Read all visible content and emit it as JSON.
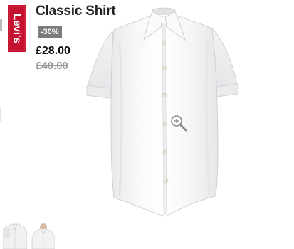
{
  "brand": {
    "logo_text": "Levi's",
    "color": "#c41230"
  },
  "product": {
    "title": "Classic Shirt",
    "discount": "-30%",
    "price_current": "£28.00",
    "price_original": "£40.00"
  },
  "image": {
    "alt": "White short sleeve shirt",
    "zoom_icon": "zoom-in-icon"
  },
  "thumbnails": [
    {
      "alt": "Shirt front view"
    },
    {
      "alt": "Shirt worn on model"
    }
  ]
}
